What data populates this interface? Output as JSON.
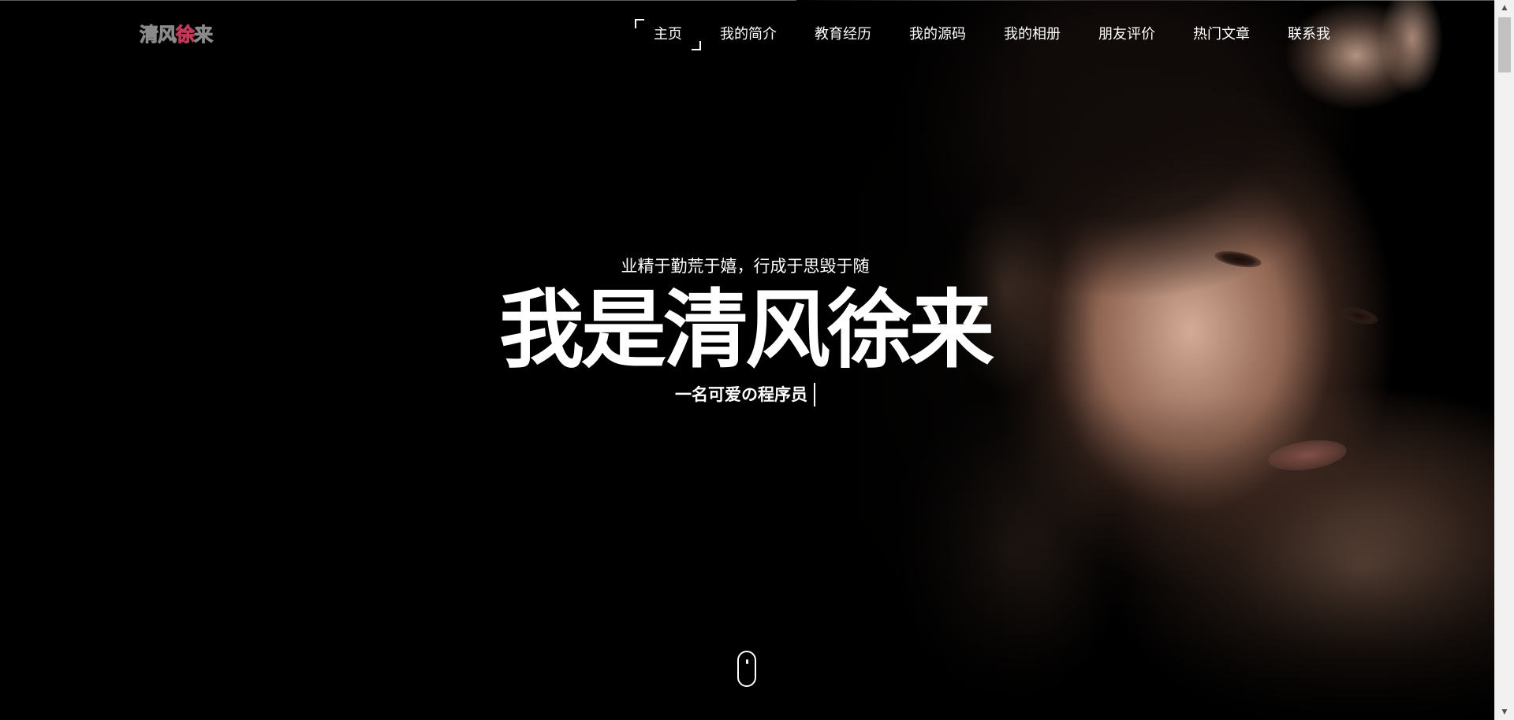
{
  "logo": {
    "part1": "清风",
    "part2": "徐",
    "part3": "来"
  },
  "nav": {
    "items": [
      {
        "label": "主页",
        "active": true
      },
      {
        "label": "我的简介"
      },
      {
        "label": "教育经历"
      },
      {
        "label": "我的源码"
      },
      {
        "label": "我的相册"
      },
      {
        "label": "朋友评价"
      },
      {
        "label": "热门文章"
      },
      {
        "label": "联系我"
      }
    ]
  },
  "hero": {
    "motto": "业精于勤荒于嬉，行成于思毁于随",
    "headline": "我是清风徐来",
    "subtitle": "一名可爱の程序员"
  },
  "icons": {
    "scroll_indicator": "mouse-scroll-icon",
    "scroll_up": "scroll-up-arrow-icon",
    "scroll_down": "scroll-down-arrow-icon"
  },
  "colors": {
    "background": "#000000",
    "text": "#ffffff",
    "logo_accent": "#9c1838",
    "logo_gray": "#4a4a4a",
    "scrollbar_track": "#f1f1f1",
    "scrollbar_thumb": "#c1c1c1"
  }
}
